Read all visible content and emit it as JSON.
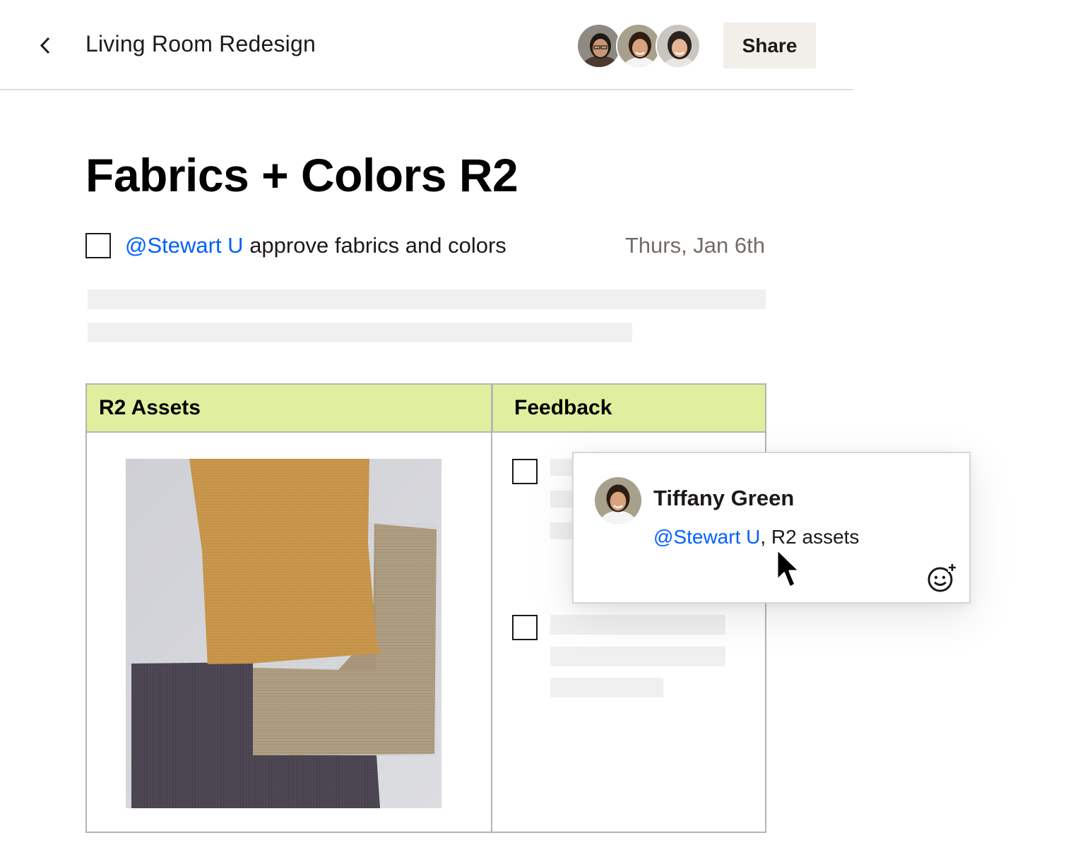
{
  "header": {
    "back_icon": "chevron-left-icon",
    "doc_title": "Living Room Redesign",
    "collaborators": [
      "avatar-1",
      "avatar-2",
      "avatar-3"
    ],
    "share_label": "Share"
  },
  "page": {
    "title": "Fabrics + Colors R2"
  },
  "task": {
    "checked": false,
    "mention": "@Stewart U",
    "text": " approve fabrics and colors",
    "date": "Thurs, Jan 6th"
  },
  "table": {
    "headers": [
      "R2 Assets",
      "Feedback"
    ],
    "feedback_items": [
      {
        "checked": false
      },
      {
        "checked": false
      }
    ]
  },
  "comment": {
    "author": "Tiffany Green",
    "mention": "@Stewart U",
    "text": ", R2 assets",
    "reaction_icon": "add-emoji-icon"
  },
  "colors": {
    "accent": "#0061fe",
    "table_header": "#dfef9d",
    "share_button": "#f2efea",
    "muted_text": "#736c64",
    "skeleton": "#f0f0f0"
  }
}
